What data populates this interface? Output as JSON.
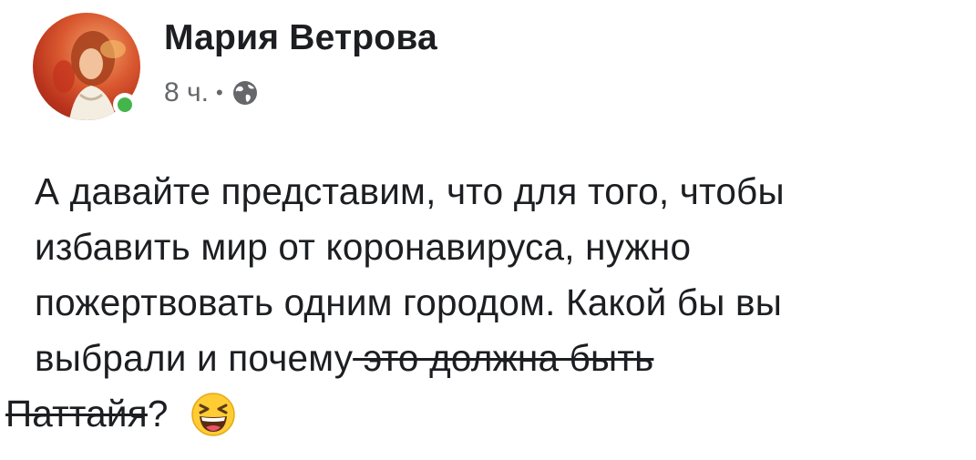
{
  "author": {
    "name": "Мария Ветрова",
    "online": true
  },
  "meta": {
    "time": "8 ч.",
    "separator": "•",
    "audience_icon": "globe-icon"
  },
  "post": {
    "lines": [
      "А давайте представим, что для того, чтобы",
      "избавить мир от коронавируса, нужно",
      "пожертвовать одним городом. Какой бы вы"
    ],
    "line4_normal": "выбрали и почему",
    "line4_struck": " это должна быть",
    "line5_struck": " Паттайя",
    "line5_end": "?",
    "emoji": "laughing-face-emoji"
  },
  "colors": {
    "online": "#44b54a",
    "text": "#1c1e21",
    "meta": "#65676b",
    "emoji": "#ffcc33"
  }
}
